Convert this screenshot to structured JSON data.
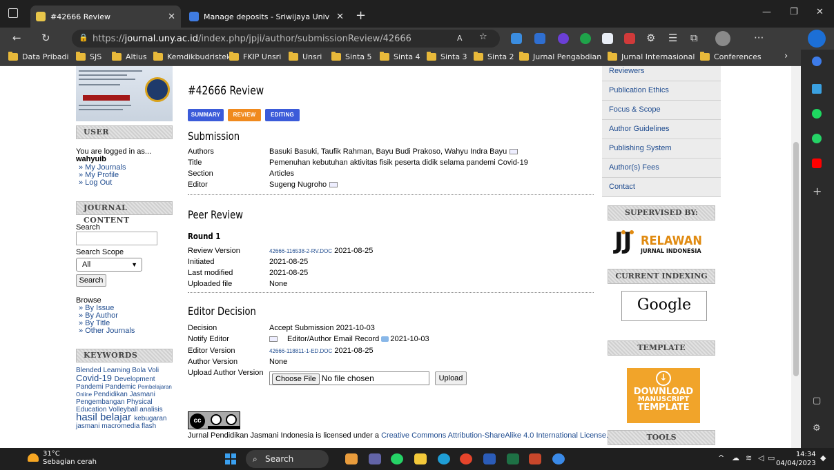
{
  "browser": {
    "tabs": [
      {
        "title": "#42666 Review",
        "active": true
      },
      {
        "title": "Manage deposits - Sriwijaya Univ",
        "active": false
      }
    ],
    "url_scheme": "https://",
    "url_host": "journal.uny.ac.id",
    "url_path": "/index.php/jpji/author/submissionReview/42666",
    "bookmarks": [
      "Data Pribadi",
      "SJS",
      "Altius",
      "Kemdikbudristek",
      "FKIP Unsri",
      "Unsri",
      "Sinta 5",
      "Sinta 4",
      "Sinta 3",
      "Sinta 2",
      "Jurnal Pengabdian",
      "Jurnal Internasional",
      "Conferences"
    ]
  },
  "left": {
    "user_head": "USER",
    "logged_in_text": "You are logged in as...",
    "username": "wahyuib",
    "user_links": [
      "» My Journals",
      "» My Profile",
      "» Log Out"
    ],
    "journal_content_head": "JOURNAL CONTENT",
    "search_label": "Search",
    "search_scope_label": "Search Scope",
    "search_scope_value": "All",
    "search_button": "Search",
    "browse_label": "Browse",
    "browse_links": [
      "» By Issue",
      "» By Author",
      "» By Title",
      "» Other Journals"
    ],
    "keywords_head": "KEYWORDS",
    "keywords": [
      {
        "text": "Blended Learning",
        "size": 10
      },
      {
        "text": "Bola Voli",
        "size": 10
      },
      {
        "text": "Covid-19",
        "size": 13
      },
      {
        "text": "Development",
        "size": 10
      },
      {
        "text": "Pandemi",
        "size": 10
      },
      {
        "text": "Pandemic",
        "size": 10
      },
      {
        "text": "Pembelajaran Online",
        "size": 8
      },
      {
        "text": "Pendidikan Jasmani",
        "size": 10
      },
      {
        "text": "Pengembangan",
        "size": 10
      },
      {
        "text": "Physical Education",
        "size": 10
      },
      {
        "text": "Volleyball",
        "size": 10
      },
      {
        "text": "analisis",
        "size": 10
      },
      {
        "text": "hasil belajar",
        "size": 15
      },
      {
        "text": "kebugaran jasmani",
        "size": 10
      },
      {
        "text": "macromedia flash",
        "size": 10
      }
    ]
  },
  "main": {
    "title": "#42666 Review",
    "subtabs": [
      "SUMMARY",
      "REVIEW",
      "EDITING"
    ],
    "submission_head": "Submission",
    "submission": [
      {
        "label": "Authors",
        "value": "Basuki Basuki, Taufik Rahman, Bayu Budi Prakoso, Wahyu Indra Bayu"
      },
      {
        "label": "Title",
        "value": "Pemenuhan kebutuhan aktivitas fisik peserta didik selama pandemi Covid-19"
      },
      {
        "label": "Section",
        "value": "Articles"
      },
      {
        "label": "Editor",
        "value": "Sugeng Nugroho"
      }
    ],
    "peer_review_head": "Peer Review",
    "round_head": "Round 1",
    "peer_review": {
      "review_version_label": "Review Version",
      "review_version_file": "42666-116538-2-RV.DOC",
      "review_version_date": "2021-08-25",
      "initiated_label": "Initiated",
      "initiated": "2021-08-25",
      "last_modified_label": "Last modified",
      "last_modified": "2021-08-25",
      "uploaded_file_label": "Uploaded file",
      "uploaded_file": "None"
    },
    "editor_decision_head": "Editor Decision",
    "editor_decision": {
      "decision_label": "Decision",
      "decision": "Accept Submission 2021-10-03",
      "notify_label": "Notify Editor",
      "notify_text": "Editor/Author Email Record",
      "notify_date": "2021-10-03",
      "editor_version_label": "Editor Version",
      "editor_version_file": "42666-118811-1-ED.DOC",
      "editor_version_date": "2021-08-25",
      "author_version_label": "Author Version",
      "author_version": "None",
      "upload_author_label": "Upload Author Version",
      "choose_file": "Choose File",
      "no_file": "No file chosen",
      "upload_button": "Upload"
    },
    "cc_badge": "cc",
    "license_prefix": "Jurnal Pendidikan Jasmani Indonesia is licensed under a ",
    "license_link": "Creative Commons Attribution-ShareAlike 4.0 International License."
  },
  "right": {
    "nav": [
      "Reviewers",
      "Publication Ethics",
      "Focus & Scope",
      "Author Guidelines",
      "Publishing System",
      "Author(s) Fees",
      "Contact"
    ],
    "supervised_head": "SUPERVISED BY:",
    "relawan_jj": "JJ",
    "relawan_word": "RELAWAN",
    "relawan_tag": "JURNAL INDONESIA",
    "indexing_head": "CURRENT INDEXING",
    "google_text": "Google",
    "template_head": "TEMPLATE",
    "download_line1": "DOWNLOAD",
    "download_line2": "MANUSCRIPT",
    "download_line3": "TEMPLATE",
    "tools_head": "TOOLS"
  },
  "taskbar": {
    "temperature": "31°C",
    "weather": "Sebagian cerah",
    "search_placeholder": "Search",
    "time": "14:34",
    "date": "04/04/2023"
  }
}
